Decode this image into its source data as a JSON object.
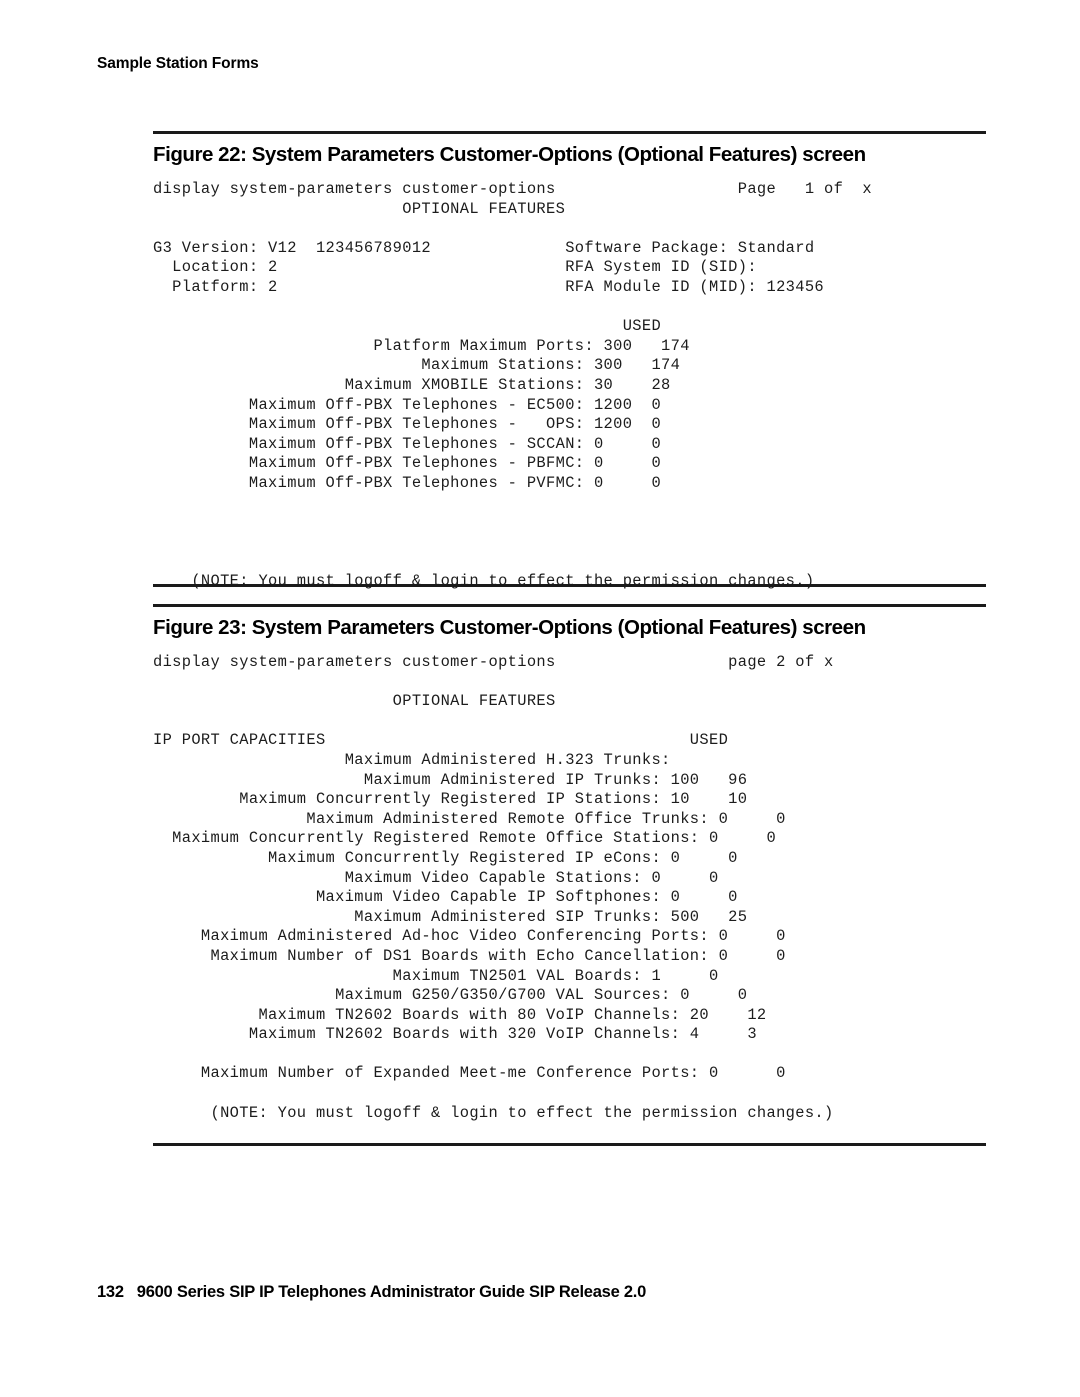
{
  "header": {
    "running_head": "Sample Station Forms"
  },
  "figures": [
    {
      "caption": "Figure 22: System Parameters Customer-Options (Optional Features) screen",
      "screen_text": "display system-parameters customer-options                   Page   1 of  x\n                          OPTIONAL FEATURES\n\nG3 Version: V12  123456789012              Software Package: Standard\n  Location: 2                              RFA System ID (SID):\n  Platform: 2                              RFA Module ID (MID): 123456\n\n                                                 USED\n                       Platform Maximum Ports: 300   174\n                            Maximum Stations: 300   174\n                    Maximum XMOBILE Stations: 30    28\n          Maximum Off-PBX Telephones - EC500: 1200  0\n          Maximum Off-PBX Telephones -   OPS: 1200  0\n          Maximum Off-PBX Telephones - SCCAN: 0     0\n          Maximum Off-PBX Telephones - PBFMC: 0     0\n          Maximum Off-PBX Telephones - PVFMC: 0     0\n\n\n\n\n    (NOTE: You must logoff & login to effect the permission changes.)"
    },
    {
      "caption": "Figure 23: System Parameters Customer-Options (Optional Features) screen",
      "screen_text": "display system-parameters customer-options                  page 2 of x\n\n                         OPTIONAL FEATURES\n\nIP PORT CAPACITIES                                      USED\n                    Maximum Administered H.323 Trunks:\n                      Maximum Administered IP Trunks: 100   96\n         Maximum Concurrently Registered IP Stations: 10    10\n                Maximum Administered Remote Office Trunks: 0     0\n  Maximum Concurrently Registered Remote Office Stations: 0     0\n            Maximum Concurrently Registered IP eCons: 0     0\n                    Maximum Video Capable Stations: 0     0\n                 Maximum Video Capable IP Softphones: 0     0\n                     Maximum Administered SIP Trunks: 500   25\n     Maximum Administered Ad-hoc Video Conferencing Ports: 0     0\n      Maximum Number of DS1 Boards with Echo Cancellation: 0     0\n                         Maximum TN2501 VAL Boards: 1     0\n                   Maximum G250/G350/G700 VAL Sources: 0     0\n           Maximum TN2602 Boards with 80 VoIP Channels: 20    12\n          Maximum TN2602 Boards with 320 VoIP Channels: 4     3\n\n     Maximum Number of Expanded Meet-me Conference Ports: 0      0\n\n      (NOTE: You must logoff & login to effect the permission changes.)"
    }
  ],
  "footer": {
    "page_number": "132",
    "document_title": "9600 Series SIP IP Telephones Administrator Guide SIP Release 2.0",
    "text": "132   9600 Series SIP IP Telephones Administrator Guide SIP Release 2.0"
  }
}
